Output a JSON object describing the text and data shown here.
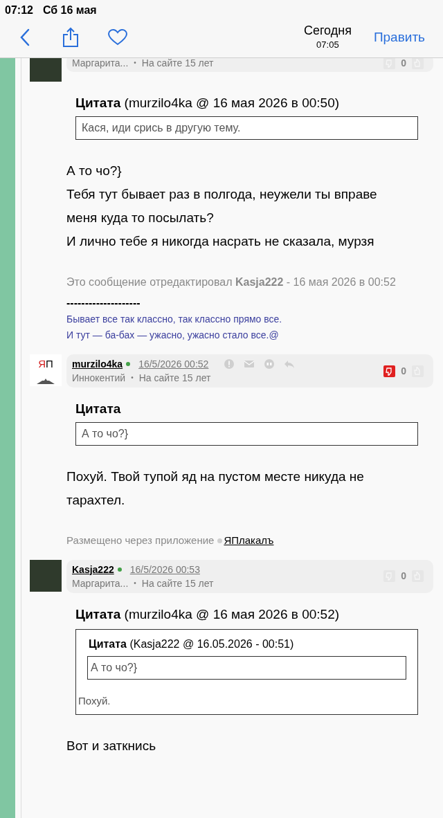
{
  "status_bar": {
    "time": "07:12",
    "date": "Сб 16 мая"
  },
  "nav": {
    "title": "Сегодня",
    "subtitle": "07:05",
    "edit": "Править"
  },
  "posts": [
    {
      "avatar": {
        "kind": "photo"
      },
      "header": {
        "user_title": "Маргарита...",
        "separator": "•",
        "tenure": "На сайте 15 лет",
        "votes": "0",
        "downvoted": false
      },
      "blocks": [
        {
          "kind": "quote",
          "title": "Цитата (murzilo4ka @ 16 мая 2026 в 00:50)",
          "text": "Кася, иди срись в другую тему."
        },
        {
          "kind": "text",
          "lines": [
            "А то чо?}",
            "Тебя тут бывает раз в полгода, неужели ты вправе меня куда то посылать?",
            "И лично тебе я никогда насрать не сказала, мурзя"
          ]
        },
        {
          "kind": "edit_note",
          "text": "Это сообщение отредактировал **Kasja222** - 16 мая 2026 в 00:52"
        },
        {
          "kind": "signature",
          "rule": "--------------------",
          "lines": [
            "Бывает все так классно, так классно прямо все.",
            "И тут — ба-бах — ужасно, ужасно стало все.@"
          ]
        }
      ]
    },
    {
      "avatar": {
        "kind": "logo",
        "letters": [
          "Я",
          "П"
        ]
      },
      "header": {
        "username": "murzilo4ka",
        "online": true,
        "date": "16/5/2026 00:52",
        "user_title": "Иннокентий",
        "separator": "•",
        "tenure": "На сайте 15 лет",
        "votes": "0",
        "downvoted": true,
        "actions": true
      },
      "blocks": [
        {
          "kind": "quote",
          "title": "Цитата",
          "text": "А то чо?}"
        },
        {
          "kind": "text",
          "lines": [
            "Похуй. Твой тупой яд на пустом месте никуда не тарахтел."
          ]
        },
        {
          "kind": "app_note",
          "text": "Размещено через приложение",
          "link": "ЯПлакалъ"
        }
      ]
    },
    {
      "avatar": {
        "kind": "photo"
      },
      "header": {
        "username": "Kasja222",
        "online": true,
        "date": "16/5/2026 00:53",
        "user_title": "Маргарита...",
        "separator": "•",
        "tenure": "На сайте 15 лет",
        "votes": "0",
        "downvoted": false,
        "actions": false
      },
      "blocks": [
        {
          "kind": "nested_quote",
          "title": "Цитата (murzilo4ka @ 16 мая 2026 в 00:52)",
          "inner_title": "Цитата (Kasja222 @ 16.05.2026 - 00:51)",
          "inner_text": "А то чо?}",
          "text": "Похуй."
        },
        {
          "kind": "text",
          "lines": [
            "Вот и заткнись"
          ]
        }
      ]
    }
  ]
}
